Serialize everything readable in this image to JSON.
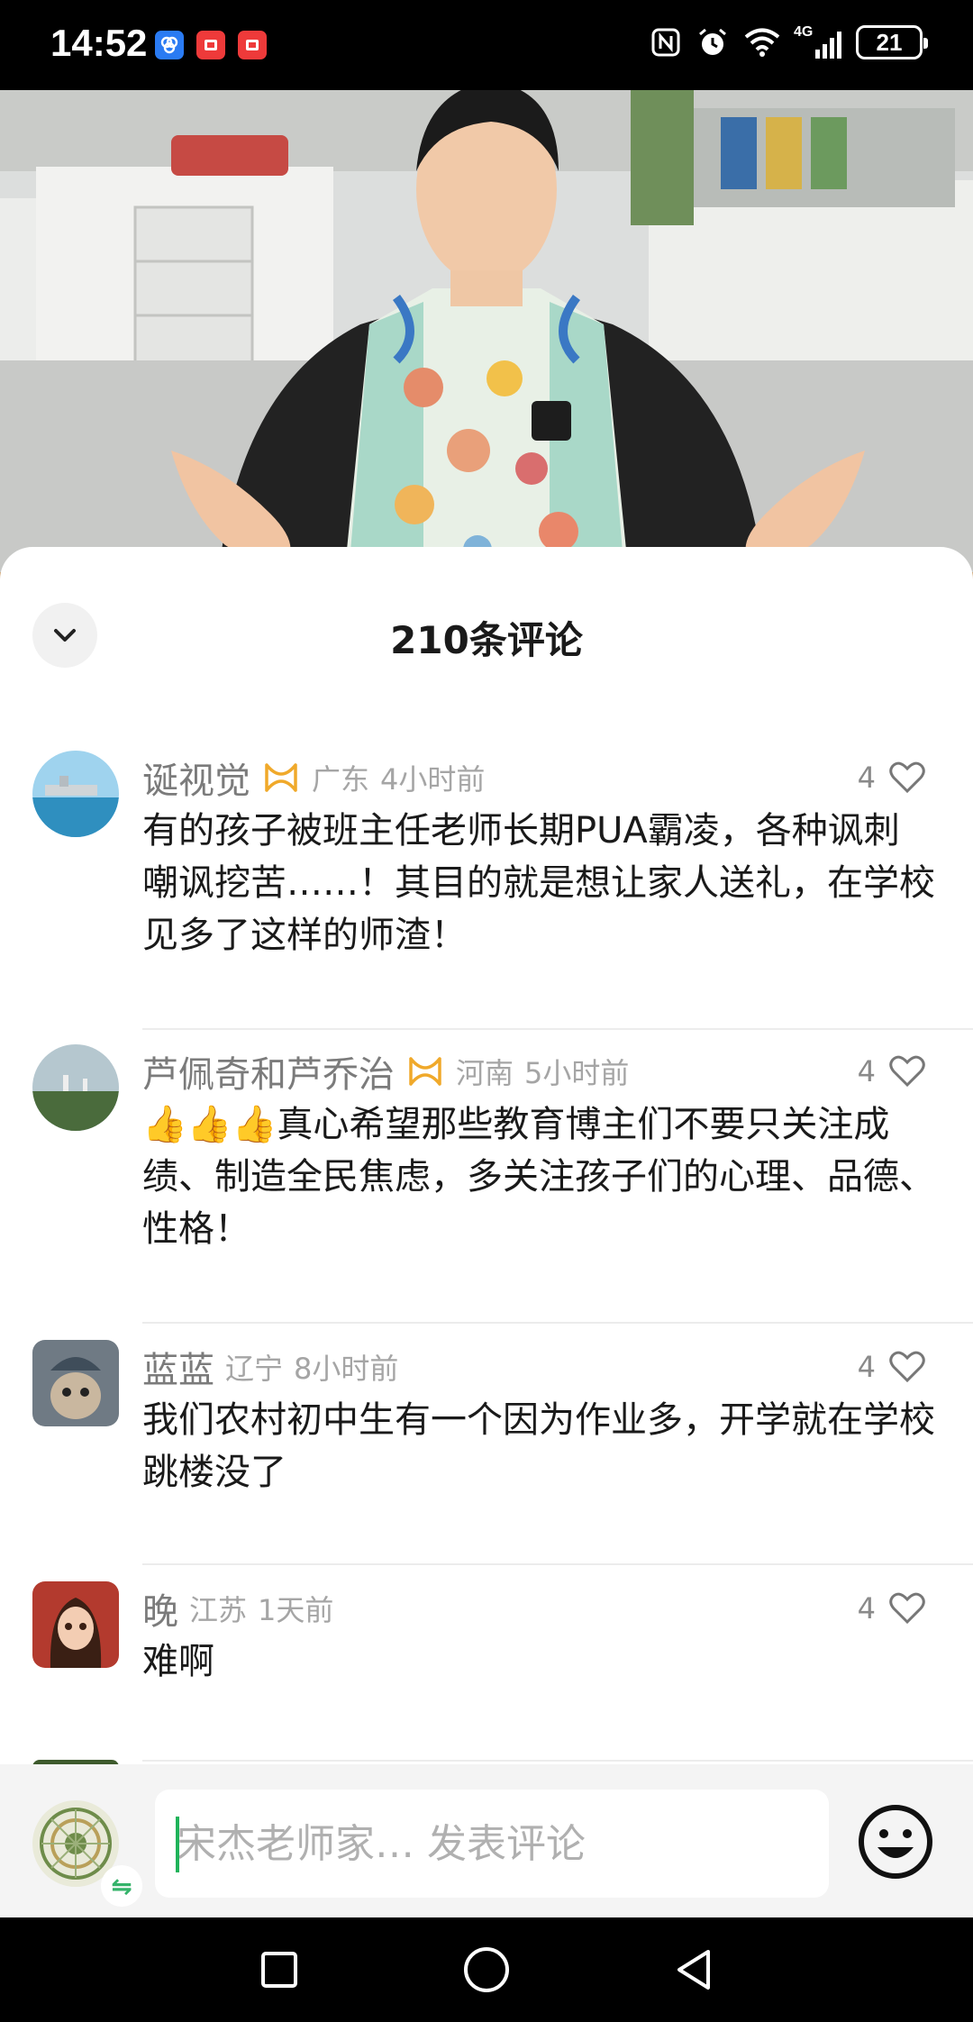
{
  "status_bar": {
    "time": "14:52",
    "battery": "21",
    "network": "4G",
    "icons": [
      "nfc-icon",
      "alarm-icon",
      "wifi-icon",
      "signal-icon",
      "battery-icon"
    ],
    "notification_icons": [
      "app-blue-icon",
      "app-red-icon",
      "app-red-icon"
    ]
  },
  "video": {
    "description_icon": "video-frame"
  },
  "comments_sheet": {
    "title": "210条评论",
    "collapse_icon": "chevron-down-icon",
    "comments": [
      {
        "name": "诞视觉",
        "has_badge": true,
        "location": "广东",
        "time": "4小时前",
        "likes": "4",
        "text": "有的孩子被班主任老师长期PUA霸凌，各种讽刺嘲讽挖苦……！其目的就是想让家人送礼，在学校见多了这样的师渣！"
      },
      {
        "name": "芦佩奇和芦乔治",
        "has_badge": true,
        "location": "河南",
        "time": "5小时前",
        "likes": "4",
        "emoji_prefix": "👍👍👍",
        "text": "真心希望那些教育博主们不要只关注成绩、制造全民焦虑，多关注孩子们的心理、品德、性格！"
      },
      {
        "name": "蓝蓝",
        "has_badge": false,
        "location": "辽宁",
        "time": "8小时前",
        "likes": "4",
        "text": "我们农村初中生有一个因为作业多，开学就在学校跳楼没了"
      },
      {
        "name": "晚",
        "has_badge": false,
        "location": "江苏",
        "time": "1天前",
        "likes": "4",
        "text": "难啊"
      }
    ]
  },
  "input_bar": {
    "placeholder": "宋杰老师家… 发表评论",
    "swap_icon": "⇋",
    "emoji_icon": "smiley-icon"
  },
  "nav_bar": {
    "buttons": [
      "recents-square-icon",
      "home-circle-icon",
      "back-triangle-icon"
    ]
  },
  "colors": {
    "accent": "#1fb35a",
    "badge": "#f0a92a",
    "muted_text": "#a5a5a5"
  }
}
